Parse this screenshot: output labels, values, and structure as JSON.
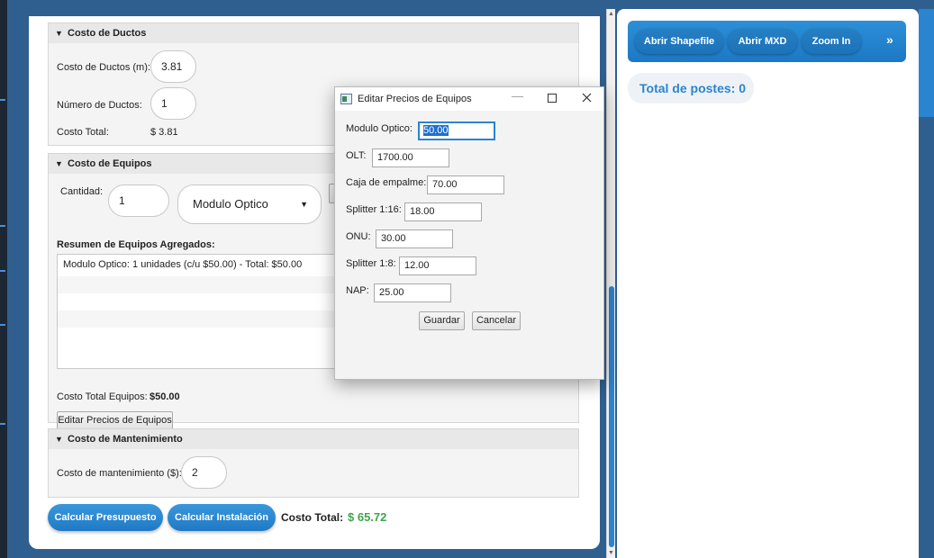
{
  "ductos": {
    "header": "Costo de Ductos",
    "costo_label": "Costo de Ductos (m):",
    "costo_value": "3.81",
    "numero_label": "Número de Ductos:",
    "numero_value": "1",
    "total_label": "Costo Total:",
    "total_value": "$ 3.81"
  },
  "equipos": {
    "header": "Costo de Equipos",
    "cantidad_label": "Cantidad:",
    "cantidad_value": "1",
    "equipo_selected": "Modulo Optico",
    "resumen_label": "Resumen de Equipos Agregados:",
    "resumen_items": [
      "Modulo Optico: 1 unidades (c/u $50.00) - Total: $50.00"
    ],
    "total_label": "Costo Total Equipos:",
    "total_value": "$50.00",
    "editar_button": "Editar Precios de Equipos"
  },
  "mantenimiento": {
    "header": "Costo de Mantenimiento",
    "label": "Costo de mantenimiento ($):",
    "value": "2"
  },
  "footer": {
    "calcular_presupuesto": "Calcular Presupuesto",
    "calcular_instalacion": "Calcular Instalación",
    "total_label": "Costo Total:",
    "total_value": "$ 65.72"
  },
  "toolbar": {
    "abrir_shapefile": "Abrir Shapefile",
    "abrir_mxd": "Abrir MXD",
    "zoom_in": "Zoom In",
    "more": "»"
  },
  "postes_label": "Total de postes: 0",
  "dialog": {
    "title": "Editar Precios de Equipos",
    "fields": [
      {
        "label": "Modulo Optico:",
        "value": "50.00"
      },
      {
        "label": "OLT:",
        "value": "1700.00"
      },
      {
        "label": "Caja de empalme:",
        "value": "70.00"
      },
      {
        "label": "Splitter 1:16:",
        "value": "18.00"
      },
      {
        "label": "ONU:",
        "value": "30.00"
      },
      {
        "label": "Splitter 1:8:",
        "value": "12.00"
      },
      {
        "label": "NAP:",
        "value": "25.00"
      }
    ],
    "guardar": "Guardar",
    "cancelar": "Cancelar"
  },
  "colors": {
    "accent": "#2a84d0",
    "total_green": "#3fa34d"
  }
}
